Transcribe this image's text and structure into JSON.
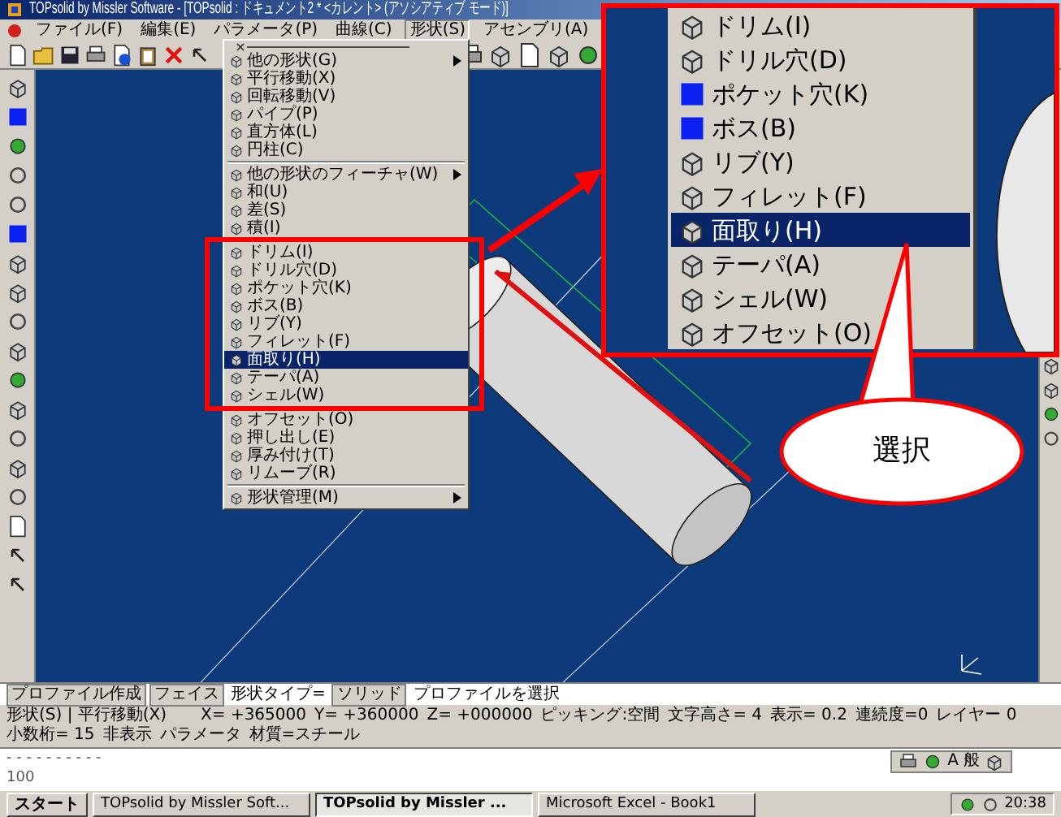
{
  "window": {
    "title": "TOPsolid by Missler Software - [TOPsolid : ドキュメント2 * <カレント> (アソシアティブ モード)]"
  },
  "menu_bar": [
    {
      "label": "ファイル(F)",
      "selected": false
    },
    {
      "label": "編集(E)",
      "selected": false
    },
    {
      "label": "パラメータ(P)",
      "selected": false
    },
    {
      "label": "曲線(C)",
      "selected": false
    },
    {
      "label": "形状(S)",
      "selected": true
    },
    {
      "label": "アセンブリ(A)",
      "selected": false
    }
  ],
  "shape_menu": {
    "groups": [
      [
        {
          "label": "他の形状(G)",
          "submenu": true,
          "selected": false
        },
        {
          "label": "平行移動(X)",
          "submenu": false,
          "selected": false
        },
        {
          "label": "回転移動(V)",
          "submenu": false,
          "selected": false
        },
        {
          "label": "パイプ(P)",
          "submenu": false,
          "selected": false
        },
        {
          "label": "直方体(L)",
          "submenu": false,
          "selected": false
        },
        {
          "label": "円柱(C)",
          "submenu": false,
          "selected": false
        }
      ],
      [
        {
          "label": "他の形状のフィーチャ(W)",
          "submenu": true,
          "selected": false
        },
        {
          "label": "和(U)",
          "submenu": false,
          "selected": false
        },
        {
          "label": "差(S)",
          "submenu": false,
          "selected": false
        },
        {
          "label": "積(I)",
          "submenu": false,
          "selected": false
        },
        {
          "kind": "highlight_frame",
          "items": [
            {
              "label": "ドリム(I)",
              "submenu": false,
              "selected": false
            },
            {
              "label": "ドリル穴(D)",
              "submenu": false,
              "selected": false
            },
            {
              "label": "ポケット穴(K)",
              "submenu": false,
              "selected": false
            },
            {
              "label": "ボス(B)",
              "submenu": false,
              "selected": false
            },
            {
              "label": "リブ(Y)",
              "submenu": false,
              "selected": false
            },
            {
              "label": "フィレット(F)",
              "submenu": false,
              "selected": false
            },
            {
              "label": "面取り(H)",
              "submenu": false,
              "selected": true
            },
            {
              "label": "テーパ(A)",
              "submenu": false,
              "selected": false
            },
            {
              "label": "シェル(W)",
              "submenu": false,
              "selected": false
            }
          ]
        },
        {
          "label": "オフセット(O)",
          "submenu": false,
          "selected": false
        },
        {
          "label": "押し出し(E)",
          "submenu": false,
          "selected": false
        },
        {
          "label": "厚み付け(T)",
          "submenu": false,
          "selected": false
        },
        {
          "label": "リムーブ(R)",
          "submenu": false,
          "selected": false
        }
      ],
      [
        {
          "label": "形状管理(M)",
          "submenu": true,
          "selected": false
        }
      ]
    ]
  },
  "zoom_inset": {
    "items": [
      {
        "label": "ドリム(I)",
        "selected": false
      },
      {
        "label": "ドリル穴(D)",
        "selected": false
      },
      {
        "label": "ポケット穴(K)",
        "selected": false
      },
      {
        "label": "ボス(B)",
        "selected": false
      },
      {
        "label": "リブ(Y)",
        "selected": false
      },
      {
        "label": "フィレット(F)",
        "selected": false
      },
      {
        "label": "面取り(H)",
        "selected": true
      },
      {
        "label": "テーパ(A)",
        "selected": false
      },
      {
        "label": "シェル(W)",
        "selected": false
      },
      {
        "label": "オフセット(O)",
        "selected": false
      }
    ]
  },
  "callout": {
    "text": "選択"
  },
  "bottom_tabs": [
    {
      "label": "プロファイル作成",
      "kind": "button"
    },
    {
      "label": "フェイス",
      "kind": "button"
    },
    {
      "label": "形状タイプ=",
      "kind": "text"
    },
    {
      "label": "ソリッド",
      "kind": "button"
    },
    {
      "label": "プロファイルを選択",
      "kind": "text"
    }
  ],
  "status_bar": {
    "left": "形状(S) | 平行移動(X)",
    "fields": [
      "X= +365000",
      "Y= +360000",
      "Z= +000000",
      "ピッキング:空間",
      "文字高さ= 4",
      "表示= 0.2",
      "連続度=0",
      "レイヤー 0",
      "小数桁= 15",
      "非表示",
      "パラメータ",
      "材質=スチール"
    ]
  },
  "command_area": {
    "lines": [
      "- - - - - - - - - -",
      "100"
    ],
    "toolbar_labels": [
      "A",
      "般"
    ]
  },
  "taskbar": {
    "start": "スタート",
    "tasks": [
      {
        "label": "TOPsolid by Missler Soft...",
        "selected": false
      },
      {
        "label": "TOPsolid by Missler ...",
        "selected": true
      },
      {
        "label": "Microsoft Excel - Book1",
        "selected": false
      }
    ],
    "clock": "20:38"
  }
}
